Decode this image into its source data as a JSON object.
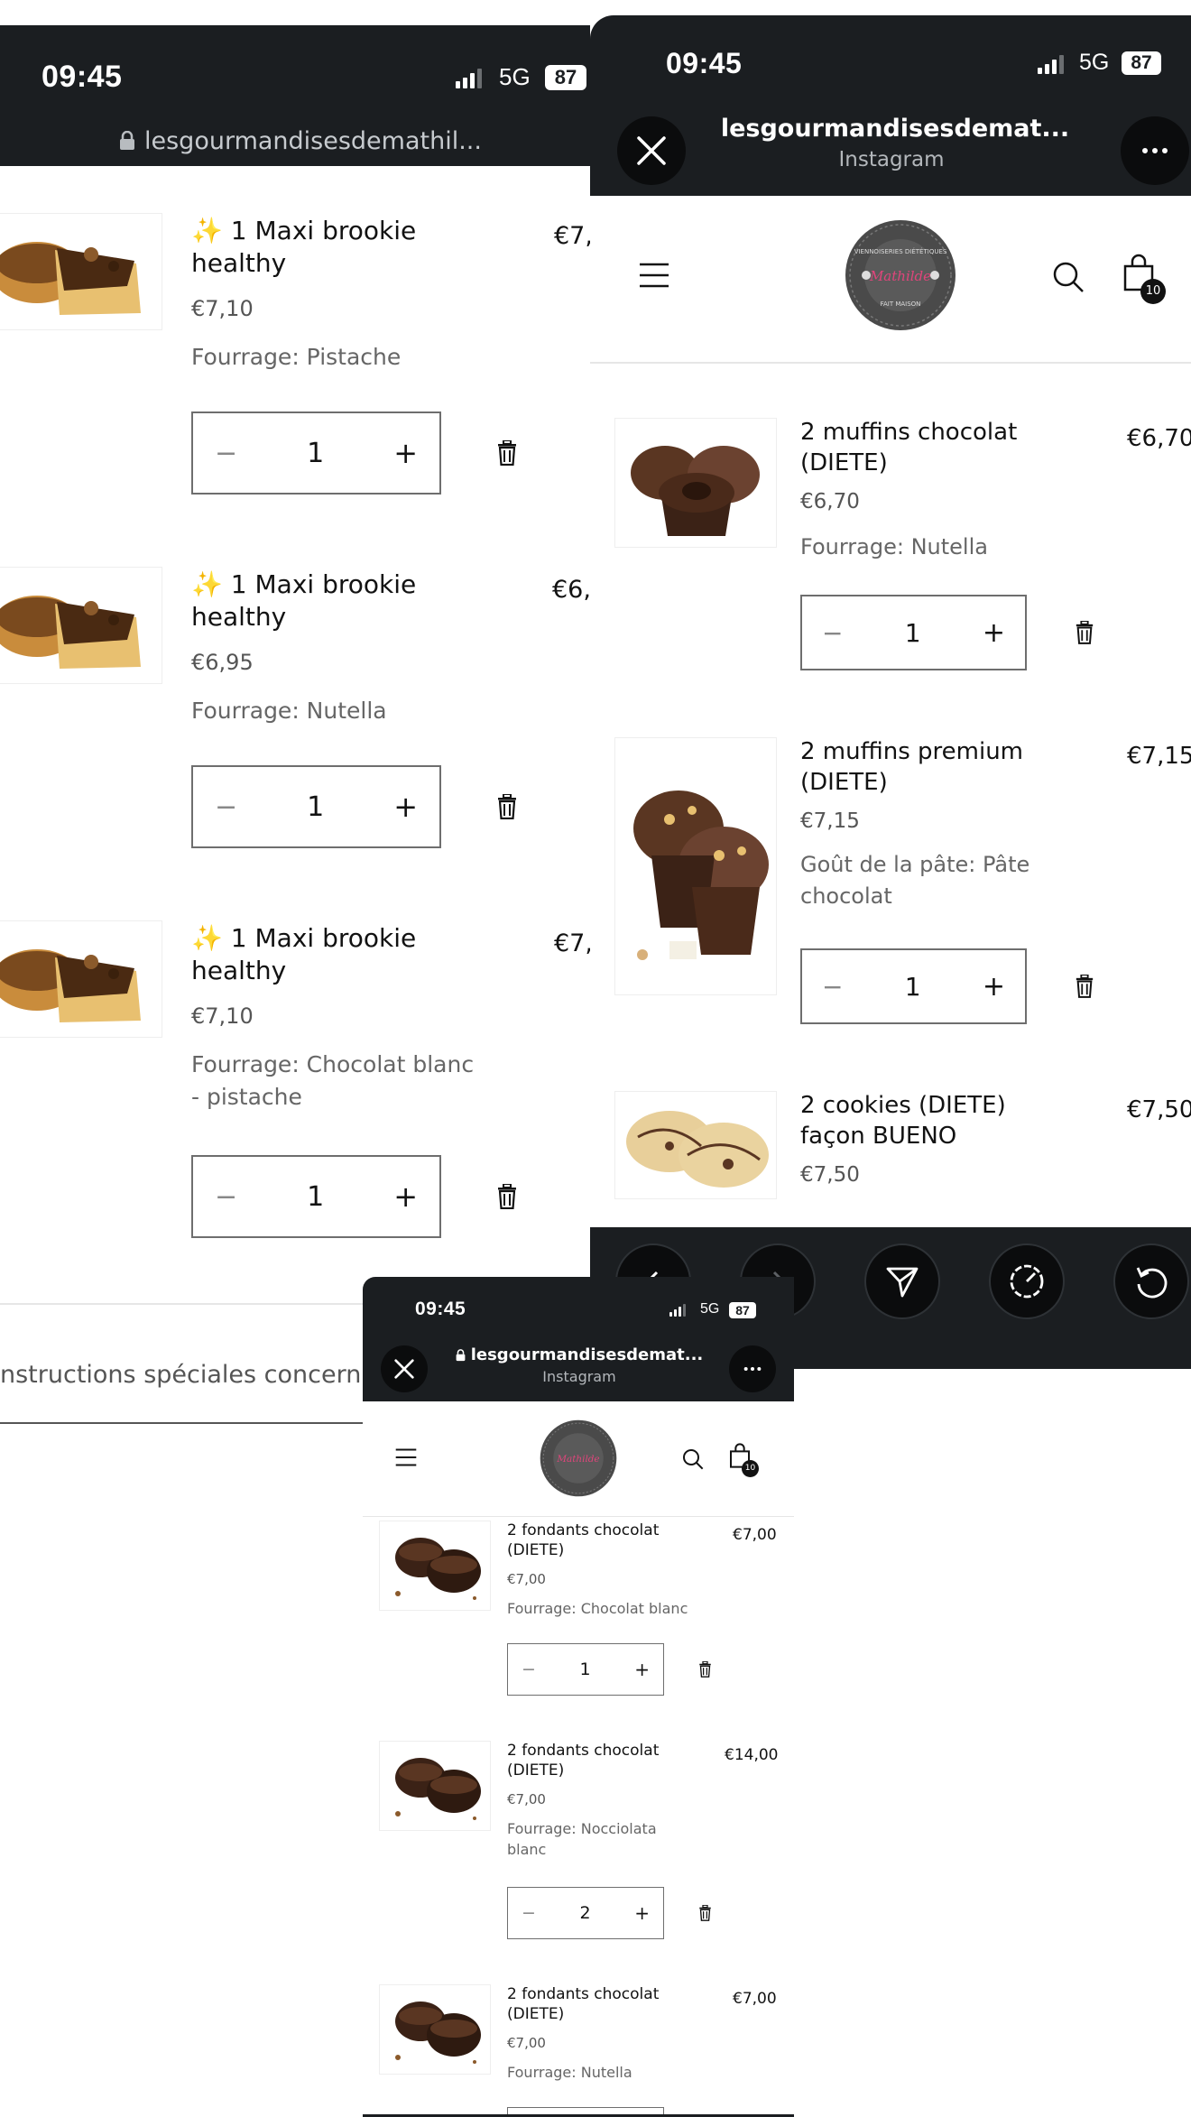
{
  "status": {
    "time": "09:45",
    "network": "5G",
    "battery": "87"
  },
  "panel_left": {
    "url": "lesgourmandisesdemathil...",
    "items": [
      {
        "emoji": "✨",
        "name": "1 Maxi brookie healthy",
        "price": "€7,10",
        "variant": "Fourrage: Pistache",
        "qty": "1",
        "total": "€7,"
      },
      {
        "emoji": "✨",
        "name": "1 Maxi brookie healthy",
        "price": "€6,95",
        "variant": "Fourrage: Nutella",
        "qty": "1",
        "total": "€6,"
      },
      {
        "emoji": "✨",
        "name": "1 Maxi brookie healthy",
        "price": "€7,10",
        "variant": "Fourrage: Chocolat blanc - pistache",
        "qty": "1",
        "total": "€7,"
      }
    ],
    "instructions_placeholder": "nstructions spéciales concerna"
  },
  "panel_right": {
    "url": "lesgourmandisesdemat...",
    "source": "Instagram",
    "cart_count": "10",
    "items": [
      {
        "name": "2 muffins chocolat (DIETE)",
        "price": "€6,70",
        "variant": "Fourrage: Nutella",
        "qty": "1",
        "total": "€6,70"
      },
      {
        "name": "2 muffins premium (DIETE)",
        "price": "€7,15",
        "variant": "Goût de la pâte: Pâte chocolat",
        "qty": "1",
        "total": "€7,15"
      },
      {
        "name": "2 cookies (DIETE) façon BUENO",
        "price": "€7,50",
        "total": "€7,50"
      }
    ]
  },
  "panel_bottom": {
    "url": "lesgourmandisesdemat...",
    "source": "Instagram",
    "cart_count": "10",
    "items": [
      {
        "name": "2 fondants chocolat (DIETE)",
        "price": "€7,00",
        "variant": "Fourrage: Chocolat blanc",
        "qty": "1",
        "total": "€7,00"
      },
      {
        "name": "2 fondants chocolat (DIETE)",
        "price": "€7,00",
        "variant": "Fourrage: Nocciolata blanc",
        "qty": "2",
        "total": "€14,00"
      },
      {
        "name": "2 fondants chocolat (DIETE)",
        "price": "€7,00",
        "variant": "Fourrage: Nutella",
        "total": "€7,00"
      }
    ]
  },
  "logo": {
    "top_text": "VIENNOISERIES DIÉTÉTIQUES",
    "name": "Mathilde",
    "bottom_text": "FAIT MAISON"
  },
  "colors": {
    "bar": "#1b1e21",
    "accent_logo": "#e0457b",
    "text": "#121212"
  },
  "icons": [
    "lock-icon",
    "close-icon",
    "more-icon",
    "menu-icon",
    "search-icon",
    "cart-icon",
    "trash-icon",
    "back-icon",
    "forward-icon",
    "share-icon",
    "compass-icon",
    "reload-icon"
  ]
}
